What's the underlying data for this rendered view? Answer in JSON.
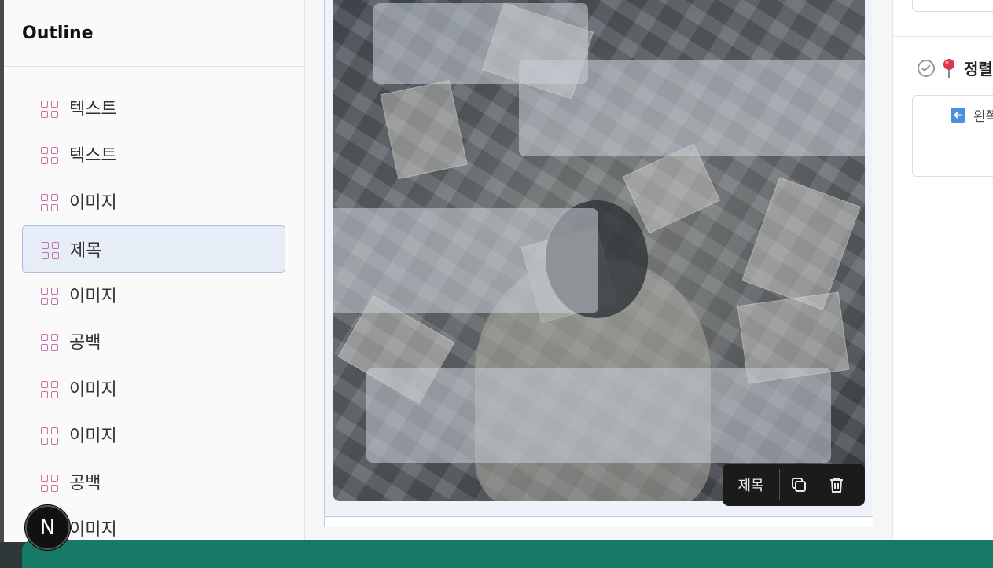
{
  "outline": {
    "title": "Outline",
    "items": [
      {
        "label": "텍스트",
        "selected": false
      },
      {
        "label": "텍스트",
        "selected": false
      },
      {
        "label": "이미지",
        "selected": false
      },
      {
        "label": "제목",
        "selected": true
      },
      {
        "label": "이미지",
        "selected": false
      },
      {
        "label": "공백",
        "selected": false
      },
      {
        "label": "이미지",
        "selected": false
      },
      {
        "label": "이미지",
        "selected": false
      },
      {
        "label": "공백",
        "selected": false
      },
      {
        "label": "이미지",
        "selected": false
      }
    ]
  },
  "badge": {
    "letter": "N"
  },
  "canvas": {
    "toolbar": {
      "block_type": "제목",
      "icons": [
        "copy-icon",
        "trash-icon"
      ]
    }
  },
  "right_panel": {
    "heading": "정렬",
    "option_label": "왼쪽",
    "icons": [
      "check-circle-icon",
      "pin-icon",
      "left-arrow-icon"
    ]
  },
  "colors": {
    "accent_icon": "#cc6fa3",
    "selected_bg": "#e6edf7",
    "bottom_bar": "#177a66",
    "toolbar_bg": "#1b1b1b"
  }
}
